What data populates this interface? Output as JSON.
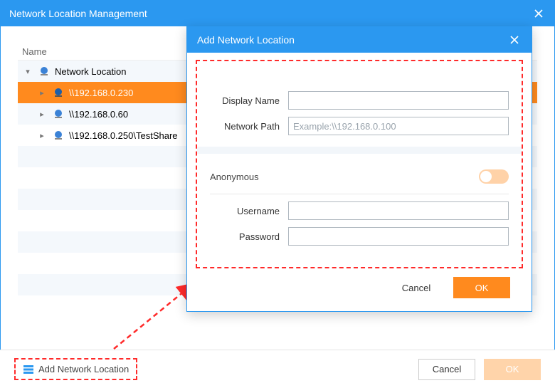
{
  "main": {
    "title": "Network Location Management",
    "name_col": "Name",
    "tree_root": "Network Location",
    "items": [
      "\\\\192.168.0.230",
      "\\\\192.168.0.60",
      "\\\\192.168.0.250\\TestShare"
    ]
  },
  "dialog": {
    "title": "Add Network Location",
    "display_name_label": "Display Name",
    "display_name_value": "",
    "network_path_label": "Network Path",
    "network_path_value": "",
    "network_path_placeholder": "Example:\\\\192.168.0.100",
    "anonymous_label": "Anonymous",
    "username_label": "Username",
    "username_value": "",
    "password_label": "Password",
    "password_value": "",
    "cancel": "Cancel",
    "ok": "OK"
  },
  "footer": {
    "add_label": "Add Network Location",
    "cancel": "Cancel",
    "ok": "OK"
  }
}
